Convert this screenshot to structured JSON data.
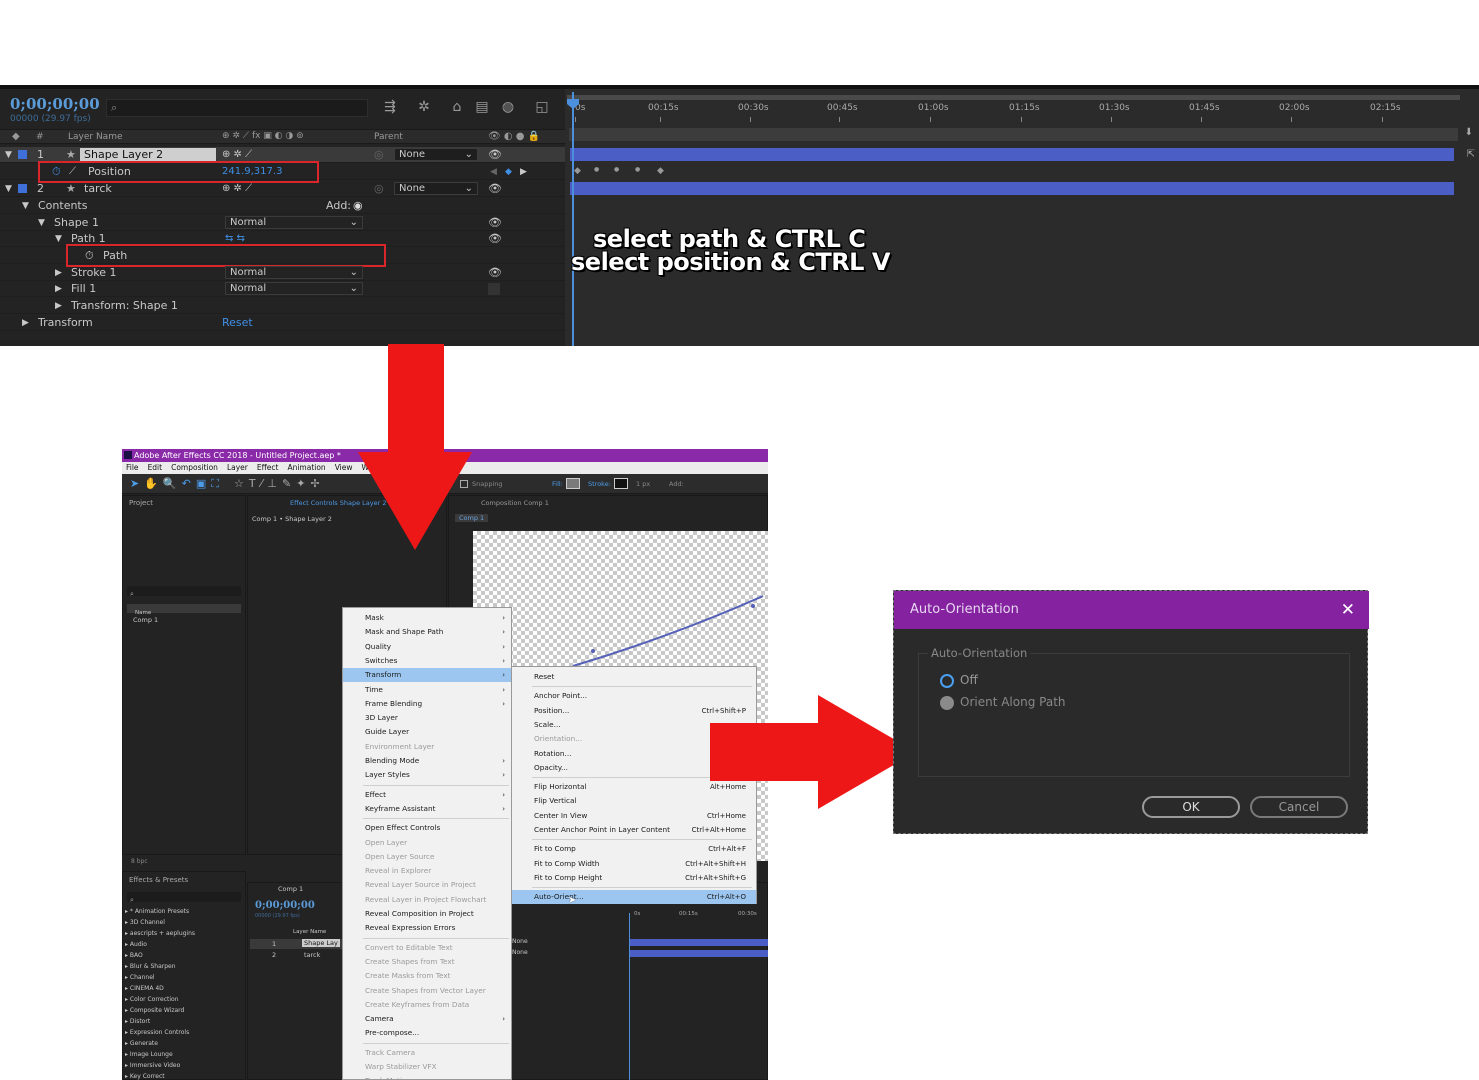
{
  "timeline": {
    "timecode": "0;00;00;00",
    "fps": "00000 (29.97 fps)",
    "columns": {
      "hash": "#",
      "layer_name": "Layer Name",
      "parent": "Parent",
      "switches_icons": "⊕ ✲ ⟋ fx ▣ ◐ ◑ ⊚"
    },
    "layers": [
      {
        "num": "1",
        "name": "Shape Layer 2",
        "parent": "None"
      },
      {
        "num": "2",
        "name": "tarck",
        "parent": "None"
      }
    ],
    "position_label": "Position",
    "position_value": "241.9,317.3",
    "contents_label": "Contents",
    "add_label": "Add:",
    "shape1_label": "Shape 1",
    "path1_label": "Path 1",
    "path_label": "Path",
    "stroke1_label": "Stroke 1",
    "fill1_label": "Fill 1",
    "transform_shape_label": "Transform: Shape 1",
    "transform_label": "Transform",
    "reset_label": "Reset",
    "blend_normal": "Normal",
    "ruler": [
      "0s",
      "00:15s",
      "00:30s",
      "00:45s",
      "01:00s",
      "01:15s",
      "01:30s",
      "01:45s",
      "02:00s",
      "02:15s"
    ],
    "overlay_line1": "select path & CTRL C",
    "overlay_line2": "select position & CTRL V"
  },
  "ae_window": {
    "title": "Adobe After Effects CC 2018 - Untitled Project.aep *",
    "menu": [
      "File",
      "Edit",
      "Composition",
      "Layer",
      "Effect",
      "Animation",
      "View",
      "Wind"
    ],
    "toolbar": {
      "snapping": "Snapping",
      "fill": "Fill:",
      "stroke": "Stroke:",
      "stroke_px": "1 px",
      "add": "Add:"
    },
    "project_tab": "Project",
    "effect_controls_tab": "Effect Controls Shape Layer 2",
    "effect_controls_sub": "Comp 1 • Shape Layer 2",
    "composition_tab": "Composition Comp 1",
    "comp_chip": "Comp 1",
    "project_col_name": "Name",
    "project_item": "Comp 1",
    "bpc": "8 bpc",
    "effects_presets_tab": "Effects & Presets",
    "effects_list": [
      "* Animation Presets",
      "3D Channel",
      "aescripts + aeplugins",
      "Audio",
      "BAO",
      "Blur & Sharpen",
      "Channel",
      "CINEMA 4D",
      "Color Correction",
      "Composite Wizard",
      "Distort",
      "Expression Controls",
      "Generate",
      "Image Lounge",
      "Immersive Video",
      "Key Correct"
    ],
    "mini_timeline": {
      "tab": "Comp 1",
      "timecode": "0;00;00;00",
      "fps": "00000 (29.97 fps)",
      "layer_name_col": "Layer Name",
      "layers": [
        {
          "num": "1",
          "name": "Shape Lay"
        },
        {
          "num": "2",
          "name": "tarck"
        }
      ],
      "parent_values": [
        "None",
        "None"
      ],
      "ruler": [
        "0s",
        "00:15s",
        "00:30s"
      ]
    },
    "context_menu": [
      {
        "label": "Mask",
        "submenu": true
      },
      {
        "label": "Mask and Shape Path",
        "submenu": true
      },
      {
        "label": "Quality",
        "submenu": true
      },
      {
        "label": "Switches",
        "submenu": true
      },
      {
        "label": "Transform",
        "submenu": true,
        "highlight": true
      },
      {
        "label": "Time",
        "submenu": true
      },
      {
        "label": "Frame Blending",
        "submenu": true
      },
      {
        "label": "3D Layer"
      },
      {
        "label": "Guide Layer"
      },
      {
        "label": "Environment Layer",
        "disabled": true
      },
      {
        "label": "Blending Mode",
        "submenu": true
      },
      {
        "label": "Layer Styles",
        "submenu": true,
        "sep_after": true
      },
      {
        "label": "Effect",
        "submenu": true
      },
      {
        "label": "Keyframe Assistant",
        "submenu": true,
        "sep_after": true
      },
      {
        "label": "Open Effect Controls"
      },
      {
        "label": "Open Layer",
        "disabled": true
      },
      {
        "label": "Open Layer Source",
        "disabled": true
      },
      {
        "label": "Reveal in Explorer",
        "disabled": true
      },
      {
        "label": "Reveal Layer Source in Project",
        "disabled": true
      },
      {
        "label": "Reveal Layer in Project Flowchart",
        "disabled": true
      },
      {
        "label": "Reveal Composition in Project"
      },
      {
        "label": "Reveal Expression Errors",
        "sep_after": true
      },
      {
        "label": "Convert to Editable Text",
        "disabled": true
      },
      {
        "label": "Create Shapes from Text",
        "disabled": true
      },
      {
        "label": "Create Masks from Text",
        "disabled": true
      },
      {
        "label": "Create Shapes from Vector Layer",
        "disabled": true
      },
      {
        "label": "Create Keyframes from Data",
        "disabled": true
      },
      {
        "label": "Camera",
        "submenu": true
      },
      {
        "label": "Pre-compose...",
        "sep_after": true
      },
      {
        "label": "Track Camera",
        "disabled": true
      },
      {
        "label": "Warp Stabilizer VFX",
        "disabled": true
      },
      {
        "label": "Track Motion",
        "disabled": true
      }
    ],
    "transform_submenu": [
      {
        "label": "Reset",
        "shortcut": "",
        "sep_after": true
      },
      {
        "label": "Anchor Point...",
        "shortcut": ""
      },
      {
        "label": "Position...",
        "shortcut": "Ctrl+Shift+P"
      },
      {
        "label": "Scale...",
        "shortcut": ""
      },
      {
        "label": "Orientation...",
        "shortcut": "Ctrl+Al",
        "disabled": true
      },
      {
        "label": "Rotation...",
        "shortcut": "Ctr"
      },
      {
        "label": "Opacity...",
        "shortcut": "Ctr",
        "sep_after": true
      },
      {
        "label": "Flip Horizontal",
        "shortcut": "Alt+Home"
      },
      {
        "label": "Flip Vertical",
        "shortcut": ""
      },
      {
        "label": "Center In View",
        "shortcut": "Ctrl+Home"
      },
      {
        "label": "Center Anchor Point in Layer Content",
        "shortcut": "Ctrl+Alt+Home",
        "sep_after": true
      },
      {
        "label": "Fit to Comp",
        "shortcut": "Ctrl+Alt+F"
      },
      {
        "label": "Fit to Comp Width",
        "shortcut": "Ctrl+Alt+Shift+H"
      },
      {
        "label": "Fit to Comp Height",
        "shortcut": "Ctrl+Alt+Shift+G",
        "sep_after": true
      },
      {
        "label": "Auto-Orient...",
        "shortcut": "Ctrl+Alt+O",
        "highlight": true
      }
    ]
  },
  "dialog": {
    "title": "Auto-Orientation",
    "close_glyph": "✕",
    "group_label": "Auto-Orientation",
    "options": [
      {
        "label": "Off",
        "selected": true
      },
      {
        "label": "Orient Along Path",
        "selected": false
      }
    ],
    "ok": "OK",
    "cancel": "Cancel"
  },
  "colors": {
    "arrow_red": "#ee1717",
    "highlight_box": "#d8262a",
    "ae_purple": "#8a2aa8",
    "timecode_blue": "#5b9bd8",
    "label_blue": "#3f6fd8"
  }
}
